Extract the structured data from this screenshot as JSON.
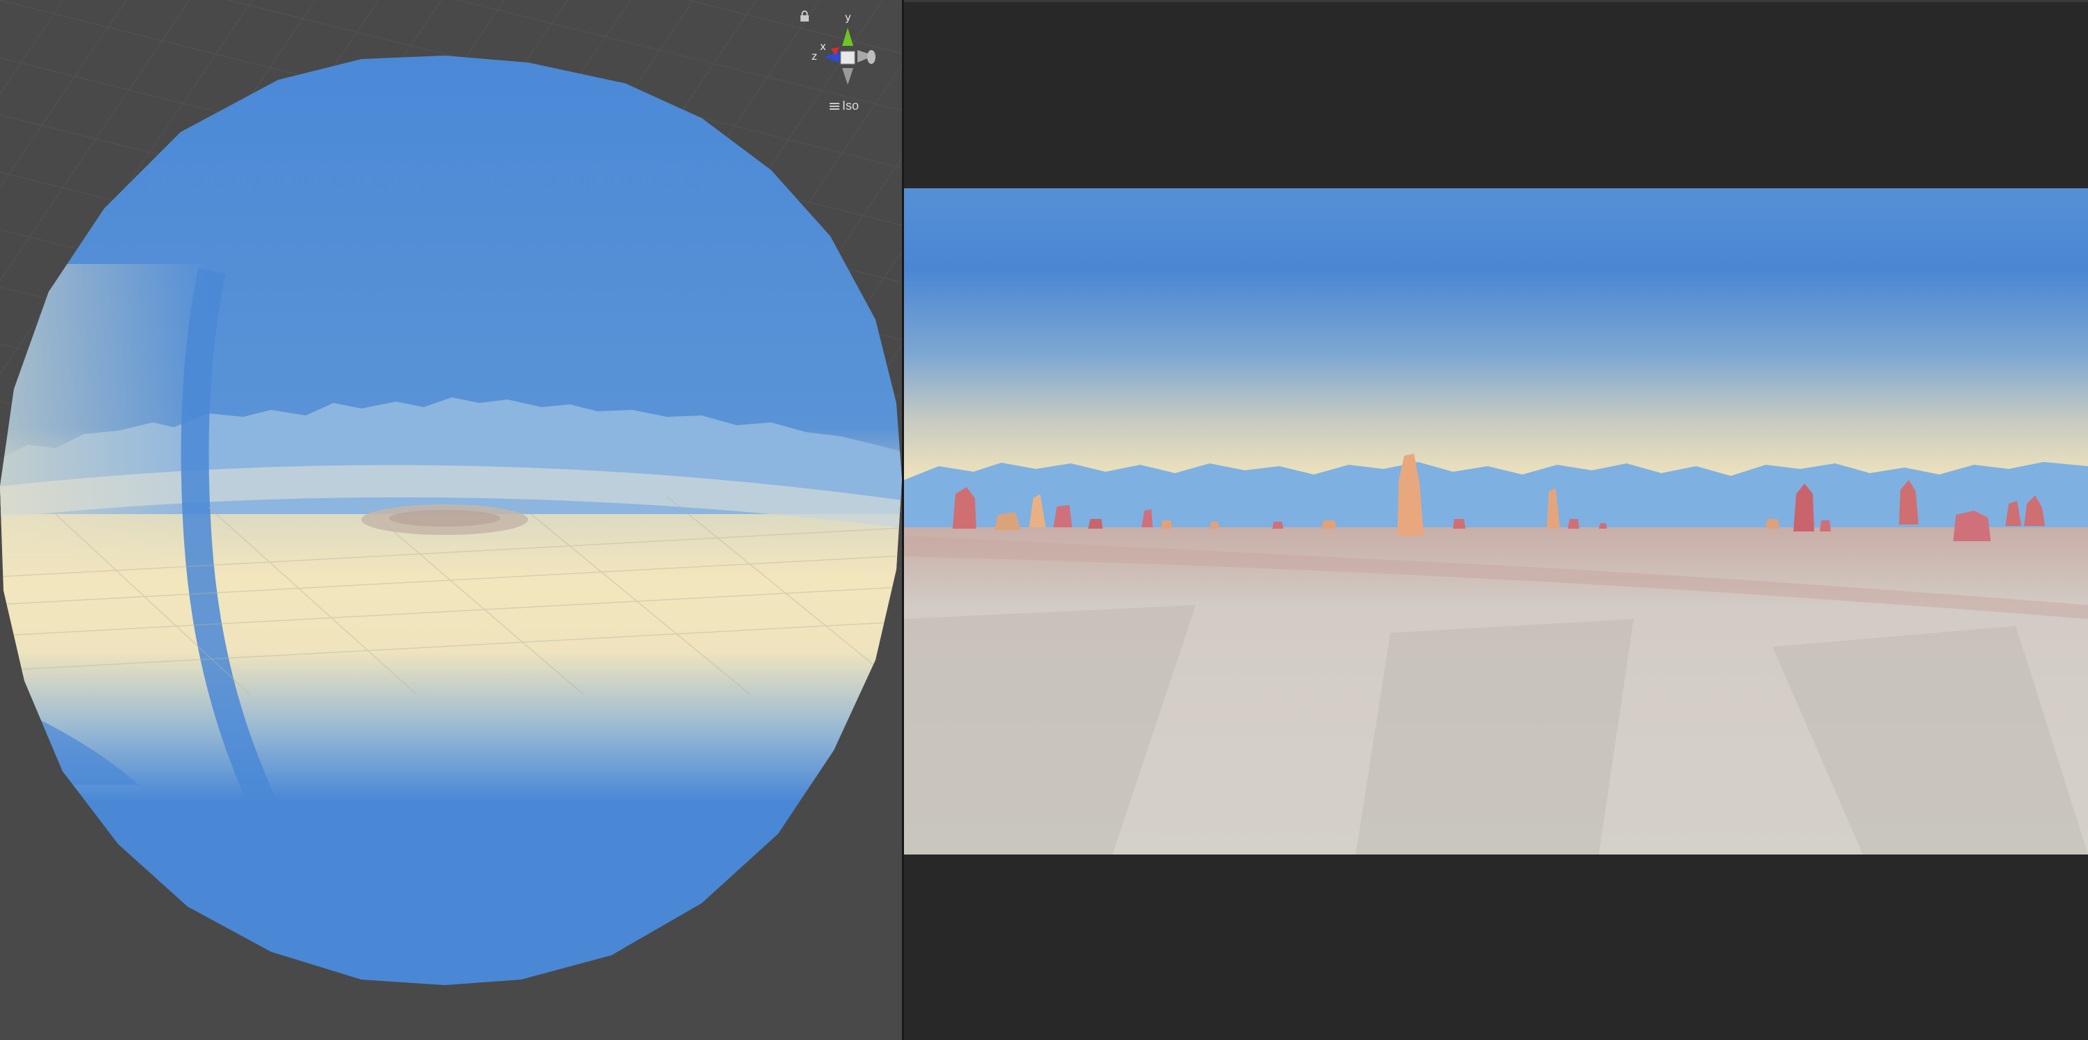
{
  "scene_view": {
    "gizmo": {
      "axis_y": "y",
      "axis_x": "x",
      "axis_z": "z",
      "projection_label": "Iso",
      "menu_icon": "hamburger-menu-icon",
      "lock_icon": "lock-icon"
    },
    "colors": {
      "background": "#494949",
      "sky_blue": "#4a88d6",
      "horizon_cream": "#f2e7bd"
    }
  },
  "game_view": {
    "colors": {
      "letterbox": "#282828",
      "sky_top": "#4a86d4",
      "horizon": "#e9dfbe",
      "mountains": "#7fb0e0",
      "ground": "#d6d1ca",
      "rocks": "#d07070"
    }
  }
}
